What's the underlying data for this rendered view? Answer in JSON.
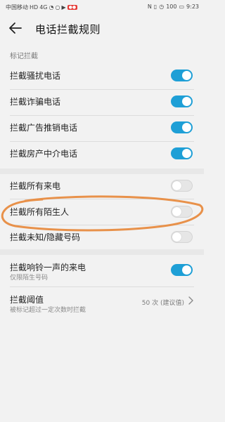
{
  "status_bar": {
    "carrier": "中国移动",
    "badges": [
      "HD",
      "4G"
    ],
    "red_badge": "●●",
    "battery": "100",
    "time": "9:23"
  },
  "header": {
    "title": "电话拦截规则",
    "back_icon": "arrow-left-icon"
  },
  "section_marked": {
    "title": "标记拦截"
  },
  "items": [
    {
      "label": "拦截骚扰电话",
      "on": true
    },
    {
      "label": "拦截诈骗电话",
      "on": true
    },
    {
      "label": "拦截广告推销电话",
      "on": true
    },
    {
      "label": "拦截房产中介电话",
      "on": true
    },
    {
      "label": "拦截所有来电",
      "on": false
    },
    {
      "label": "拦截所有陌生人",
      "on": false
    },
    {
      "label": "拦截未知/隐藏号码",
      "on": false
    },
    {
      "label": "拦截响铃一声的来电",
      "sub": "仅限陌生号码",
      "on": true
    }
  ],
  "threshold": {
    "label": "拦截阈值",
    "sub": "被标记超过一定次数时拦截",
    "value": "50 次 (建议值)"
  },
  "colors": {
    "toggle_on": "#1e9fd6",
    "annotation": "#e8914a"
  }
}
